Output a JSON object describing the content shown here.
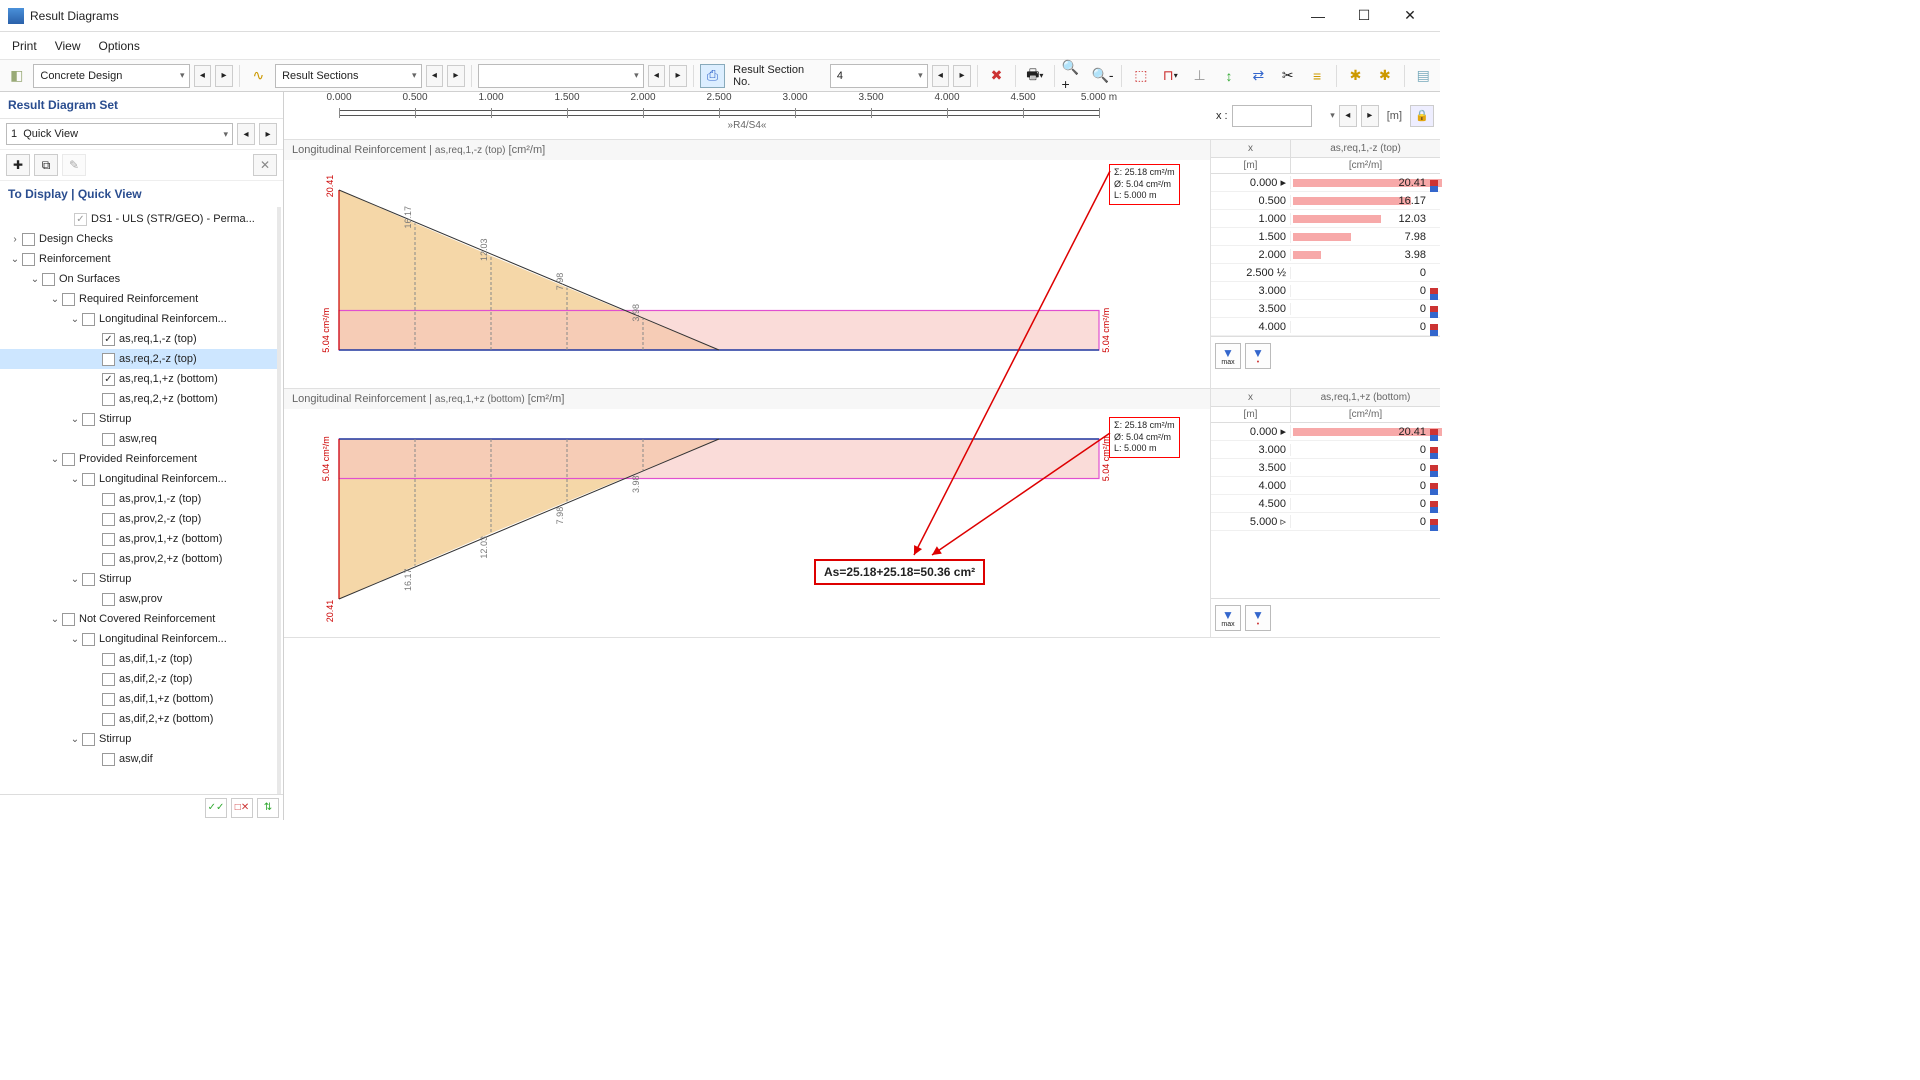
{
  "window": {
    "title": "Result Diagrams"
  },
  "menu": {
    "print": "Print",
    "view": "View",
    "options": "Options"
  },
  "toolbar": {
    "design_icon": "concrete-design-icon",
    "design_combo": "Concrete Design",
    "section_icon": "result-sections-icon",
    "section_combo": "Result Sections",
    "section_no_label": "Result Section No.",
    "section_no_value": "4"
  },
  "sidebar": {
    "set_header": "Result Diagram Set",
    "set_combo_idx": "1",
    "set_combo_label": "Quick View",
    "display_header": "To Display | Quick View",
    "ds_label": "DS1 - ULS (STR/GEO) - Perma...",
    "tree": {
      "design_checks": "Design Checks",
      "reinforcement": "Reinforcement",
      "on_surfaces": "On Surfaces",
      "required": "Required Reinforcement",
      "long_reinf": "Longitudinal Reinforcem...",
      "items_req": [
        {
          "label": "as,req,1,-z (top)",
          "checked": true
        },
        {
          "label": "as,req,2,-z (top)",
          "checked": false,
          "selected": true
        },
        {
          "label": "as,req,1,+z (bottom)",
          "checked": true
        },
        {
          "label": "as,req,2,+z (bottom)",
          "checked": false
        }
      ],
      "stirrup": "Stirrup",
      "asw_req": "asw,req",
      "provided": "Provided Reinforcement",
      "items_prov": [
        "as,prov,1,-z (top)",
        "as,prov,2,-z (top)",
        "as,prov,1,+z (bottom)",
        "as,prov,2,+z (bottom)"
      ],
      "asw_prov": "asw,prov",
      "not_covered": "Not Covered Reinforcement",
      "items_dif": [
        "as,dif,1,-z (top)",
        "as,dif,2,-z (top)",
        "as,dif,1,+z (bottom)",
        "as,dif,2,+z (bottom)"
      ],
      "asw_dif": "asw,dif"
    }
  },
  "ruler": {
    "ticks": [
      "0.000",
      "0.500",
      "1.000",
      "1.500",
      "2.000",
      "2.500",
      "3.000",
      "3.500",
      "4.000",
      "4.500",
      "5.000 m"
    ],
    "section_name": "»R4/S4«",
    "x_label": "x :",
    "unit": "[m]"
  },
  "diagram1": {
    "title_prefix": "Longitudinal Reinforcement | ",
    "title_var": "as,req,1,-z (top)",
    "title_unit": " [cm²/m]",
    "info": {
      "sum": "Σ:  25.18  cm²/m",
      "avg": "Ø:   5.04  cm²/m",
      "len": "L:   5.000  m"
    },
    "y_left": "5.04 cm²/m",
    "y_right": "5.04 cm²/m",
    "peak": "20.41",
    "bar_labels": [
      "16.17",
      "12.03",
      "7.98",
      "3.98"
    ],
    "table": {
      "x_header": "x",
      "x_unit": "[m]",
      "v_header": "as,req,1,-z (top)",
      "v_unit": "[cm²/m]",
      "rows": [
        {
          "x": "0.000",
          "v": "20.41",
          "bar": 100,
          "mark": true,
          "cursor": "▸"
        },
        {
          "x": "0.500",
          "v": "16.17",
          "bar": 79
        },
        {
          "x": "1.000",
          "v": "12.03",
          "bar": 59
        },
        {
          "x": "1.500",
          "v": "7.98",
          "bar": 39
        },
        {
          "x": "2.000",
          "v": "3.98",
          "bar": 19
        },
        {
          "x": "2.500",
          "v": "0",
          "bar": 0,
          "half": "½"
        },
        {
          "x": "3.000",
          "v": "0",
          "bar": 0,
          "mark": true
        },
        {
          "x": "3.500",
          "v": "0",
          "bar": 0,
          "mark": true
        },
        {
          "x": "4.000",
          "v": "0",
          "bar": 0,
          "mark": true
        }
      ]
    }
  },
  "diagram2": {
    "title_prefix": "Longitudinal Reinforcement | ",
    "title_var": "as,req,1,+z (bottom)",
    "title_unit": " [cm²/m]",
    "info": {
      "sum": "Σ:  25.18  cm²/m",
      "avg": "Ø:   5.04  cm²/m",
      "len": "L:   5.000  m"
    },
    "y_left": "5.04 cm²/m",
    "y_right": "5.04 cm²/m",
    "peak": "20.41",
    "bar_labels": [
      "16.17",
      "12.03",
      "7.98",
      "3.98"
    ],
    "table": {
      "x_header": "x",
      "x_unit": "[m]",
      "v_header": "as,req,1,+z (bottom)",
      "v_unit": "[cm²/m]",
      "rows": [
        {
          "x": "0.000",
          "v": "20.41",
          "bar": 100,
          "mark": true,
          "cursor": "▸"
        },
        {
          "x": "3.000",
          "v": "0",
          "bar": 0,
          "mark": true
        },
        {
          "x": "3.500",
          "v": "0",
          "bar": 0,
          "mark": true
        },
        {
          "x": "4.000",
          "v": "0",
          "bar": 0,
          "mark": true
        },
        {
          "x": "4.500",
          "v": "0",
          "bar": 0,
          "mark": true
        },
        {
          "x": "5.000",
          "v": "0",
          "bar": 0,
          "mark": true,
          "cursor2": "▹"
        }
      ]
    }
  },
  "annotation": {
    "text": "As=25.18+25.18=50.36 cm²"
  },
  "chart_data": [
    {
      "type": "area",
      "title": "Longitudinal Reinforcement as,req,1,-z (top) [cm²/m]",
      "x": [
        0.0,
        0.5,
        1.0,
        1.5,
        2.0,
        2.5,
        3.0,
        3.5,
        4.0,
        4.5,
        5.0
      ],
      "values": [
        20.41,
        16.17,
        12.03,
        7.98,
        3.98,
        0,
        0,
        0,
        0,
        0,
        0
      ],
      "reference_line": 5.04,
      "sum": 25.18,
      "avg": 5.04,
      "length": 5.0,
      "xlabel": "x [m]",
      "ylabel": "cm²/m",
      "ylim": [
        0,
        21
      ]
    },
    {
      "type": "area",
      "title": "Longitudinal Reinforcement as,req,1,+z (bottom) [cm²/m]",
      "x": [
        0.0,
        0.5,
        1.0,
        1.5,
        2.0,
        2.5,
        3.0,
        3.5,
        4.0,
        4.5,
        5.0
      ],
      "values": [
        20.41,
        16.17,
        12.03,
        7.98,
        3.98,
        0,
        0,
        0,
        0,
        0,
        0
      ],
      "reference_line": 5.04,
      "sum": 25.18,
      "avg": 5.04,
      "length": 5.0,
      "xlabel": "x [m]",
      "ylabel": "cm²/m",
      "ylim": [
        0,
        21
      ],
      "orientation": "flipped"
    }
  ]
}
